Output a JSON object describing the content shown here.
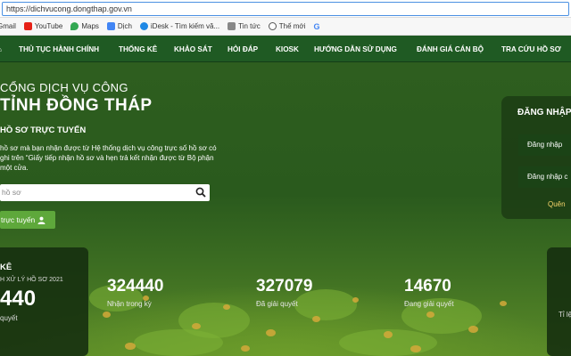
{
  "browser": {
    "url": "https://dichvucong.dongthap.gov.vn",
    "bookmarks": [
      "Gmail",
      "YouTube",
      "Maps",
      "Dịch",
      "iDesk - Tìm kiếm vă...",
      "Tin tức",
      "Thế mới",
      "G"
    ]
  },
  "nav": {
    "items": [
      "THỦ TỤC HÀNH CHÍNH",
      "THỐNG KÊ",
      "KHẢO SÁT",
      "HỎI ĐÁP",
      "KIOSK",
      "HƯỚNG DẪN SỬ DỤNG",
      "ĐÁNH GIÁ CÁN BỘ",
      "TRA CỨU HỒ SƠ"
    ]
  },
  "hero": {
    "title_line1": "CỔNG DỊCH VỤ CÔNG",
    "title_line2": "TỈNH ĐỒNG THÁP",
    "subtitle": "HỒ SƠ TRỰC TUYẾN",
    "description": "hồ sơ mà bạn nhận được từ Hệ thống dịch vụ công trực số hồ sơ có ghi trên “Giấy tiếp nhận hồ sơ và hẹn trả kết nhận được từ Bộ phận một cửa.",
    "search_placeholder": "hồ sơ",
    "submit_label": "trực tuyến"
  },
  "stats_card": {
    "heading": "KÊ",
    "subheading": "H XỬ LÝ HỒ SƠ 2021",
    "number": "440",
    "label": "quyết"
  },
  "stats": [
    {
      "value": "324440",
      "label": "Nhận trong kỳ"
    },
    {
      "value": "327079",
      "label": "Đã giải quyết"
    },
    {
      "value": "14670",
      "label": "Đang giải quyết"
    }
  ],
  "login": {
    "heading": "ĐĂNG NHẬP",
    "btn1": "Đăng nhập",
    "btn2": "Đăng nhập c",
    "link": "Quên"
  },
  "right_card": {
    "text": "Tỉ lệ"
  },
  "colors": {
    "nav_bg": "#1f5a23",
    "submit_green": "#5ea83b",
    "link_yellow": "#f5d36a"
  }
}
